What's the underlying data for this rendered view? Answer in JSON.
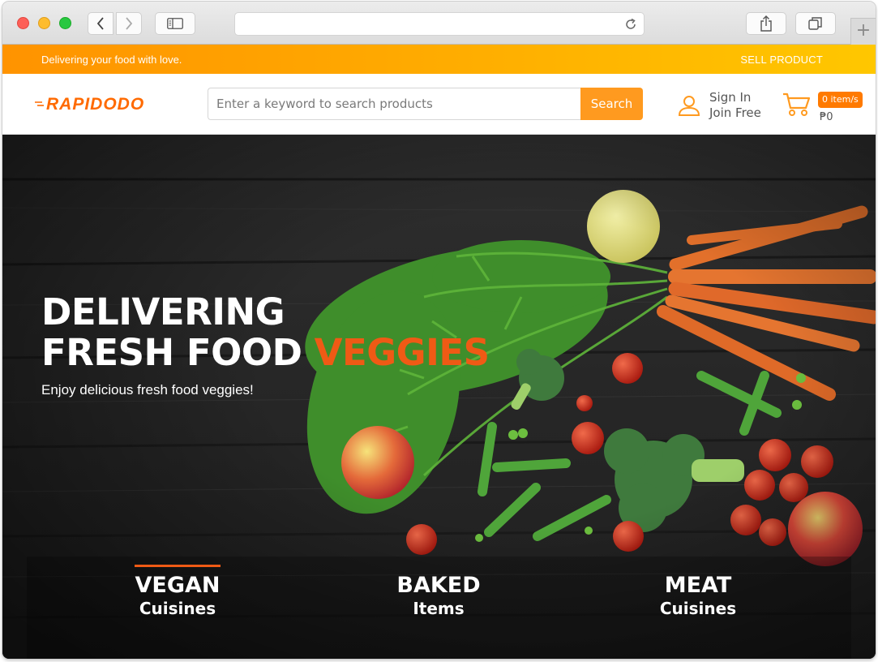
{
  "browser": {
    "url": "",
    "newtab_label": "+"
  },
  "promo": {
    "tagline": "Delivering your food with love.",
    "sell_link": "SELL PRODUCT"
  },
  "header": {
    "logo_text": "RAPIDODO",
    "search": {
      "placeholder": "Enter a keyword to search products",
      "value": "",
      "button_label": "Search"
    },
    "account": {
      "sign_in": "Sign In",
      "join": "Join Free"
    },
    "cart": {
      "badge": "0 item/s",
      "total": "₱0"
    }
  },
  "hero": {
    "headline_line1": "DELIVERING",
    "headline_line2": "FRESH FOOD",
    "headline_accent": "VEGGIES",
    "subline": "Enjoy delicious fresh food veggies!",
    "categories": [
      {
        "title": "VEGAN",
        "subtitle": "Cuisines",
        "active": true
      },
      {
        "title": "BAKED",
        "subtitle": "Items",
        "active": false
      },
      {
        "title": "MEAT",
        "subtitle": "Cuisines",
        "active": false
      }
    ]
  },
  "colors": {
    "accent_orange": "#ff9a1f",
    "headline_accent": "#ef5a15",
    "promo_gradient_start": "#ff9300",
    "promo_gradient_end": "#ffc700"
  }
}
